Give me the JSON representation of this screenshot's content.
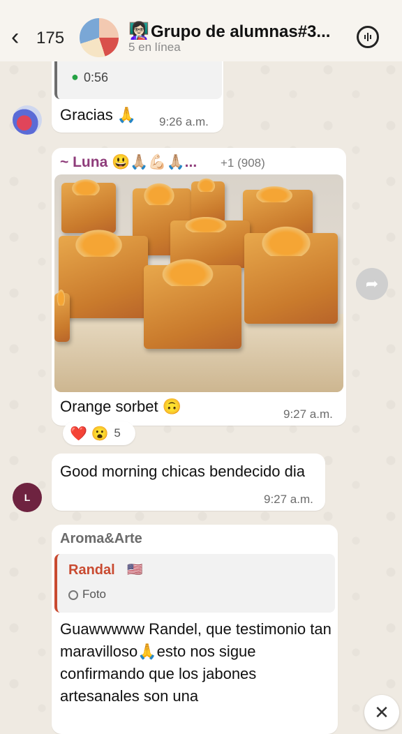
{
  "header": {
    "back_glyph": "‹",
    "back_count": "175",
    "title_emoji": "👩🏻‍🏫",
    "title": "Grupo de alumnas#3...",
    "subtitle": "5 en línea",
    "call_icon": "voice-call-icon"
  },
  "messages": [
    {
      "audio_duration": "0:56",
      "text": "Gracias 🙏",
      "time": "9:26 a.m."
    },
    {
      "sender": "~ Luna 😃🙏🏼💪🏻🙏🏼...",
      "sender_extra": "+1 (908)",
      "caption": "Orange sorbet 🙃",
      "time": "9:27 a.m.",
      "reactions": {
        "emojis": "❤️ 😮",
        "count": "5"
      }
    },
    {
      "avatar_letter": "L",
      "text": "Good morning chicas bendecido dia",
      "time": "9:27 a.m."
    },
    {
      "sender": "Aroma&Arte",
      "quote_name": "Randal",
      "quote_flag": "🇺🇸",
      "quote_type": "Foto",
      "text": "Guawwwww Randel, que testimonio tan maravilloso🙏esto nos sigue confirmando que los jabones artesanales son una"
    }
  ]
}
